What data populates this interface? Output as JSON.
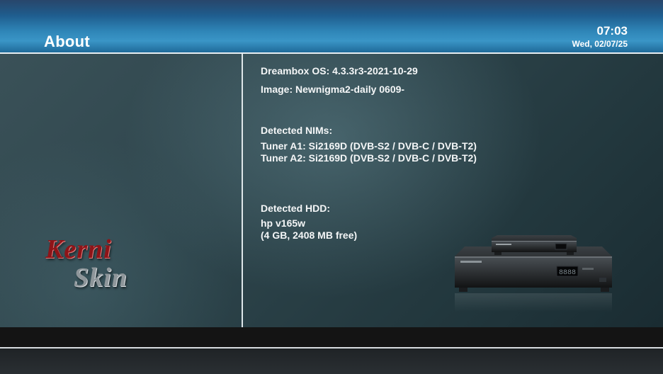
{
  "header": {
    "title": "About",
    "time": "07:03",
    "date": "Wed, 02/07/25"
  },
  "logo": {
    "line1": "Kerni",
    "line2": "Skin"
  },
  "info": {
    "os": "Dreambox OS: 4.3.3r3-2021-10-29",
    "image": "Image: Newnigma2-daily 0609-",
    "nims_heading": "Detected NIMs:",
    "tuners": [
      "Tuner A1: Si2169D (DVB-S2 / DVB-C / DVB-T2)",
      "Tuner A2: Si2169D (DVB-S2 / DVB-C / DVB-T2)"
    ],
    "hdd_heading": "Detected HDD:",
    "hdd_model": "hp v165w",
    "hdd_size": "(4 GB, 2408 MB free)"
  },
  "colors": {
    "header_blue": "#2f86b8",
    "logo_red": "#8e1418",
    "logo_gray": "#8e969a"
  },
  "icons": [
    "receiver-device-image"
  ]
}
